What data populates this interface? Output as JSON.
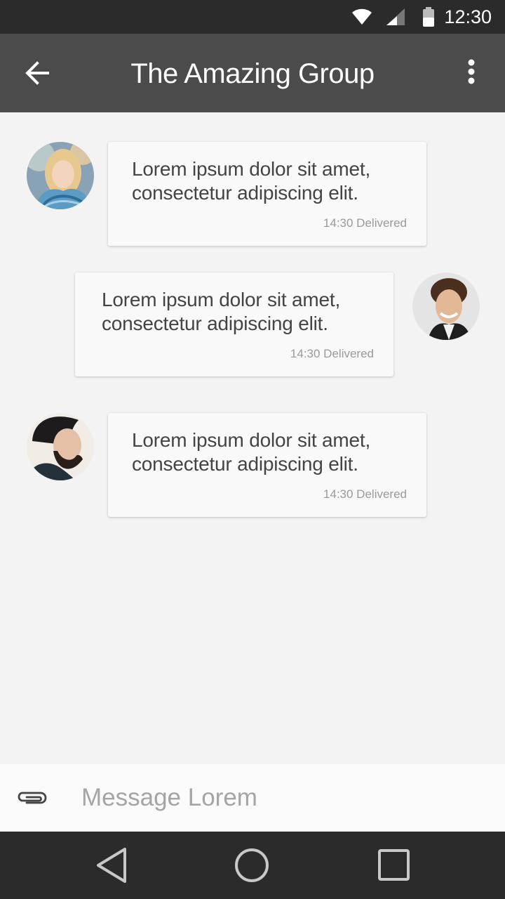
{
  "status_bar": {
    "time": "12:30",
    "icons": [
      "wifi-icon",
      "cell-signal-icon",
      "battery-icon"
    ]
  },
  "app_bar": {
    "title": "The Amazing Group",
    "back_icon": "arrow-left-icon",
    "menu_icon": "more-vert-icon"
  },
  "messages": [
    {
      "side": "left",
      "avatar": "avatar-blonde-woman",
      "text": "Lorem ipsum dolor sit amet, consectetur adipiscing elit.",
      "meta": "14:30 Delivered"
    },
    {
      "side": "right",
      "avatar": "avatar-curly-hair-man",
      "text": "Lorem ipsum dolor sit amet, consectetur adipiscing elit.",
      "meta": "14:30 Delivered"
    },
    {
      "side": "left",
      "avatar": "avatar-bearded-man",
      "text": "Lorem ipsum dolor sit amet, consectetur adipiscing elit.",
      "meta": "14:30 Delivered"
    }
  ],
  "composer": {
    "attach_icon": "paperclip-icon",
    "placeholder": "Message Lorem",
    "value": ""
  },
  "nav_bar": {
    "buttons": [
      "back-triangle-icon",
      "home-circle-icon",
      "recents-square-icon"
    ]
  },
  "colors": {
    "status_bar_bg": "#2b2b2b",
    "app_bar_bg": "#4b4b4b",
    "chat_bg": "#f3f3f3",
    "bubble_bg": "#f9f9f9",
    "nav_bar_bg": "#2b2b2b"
  }
}
